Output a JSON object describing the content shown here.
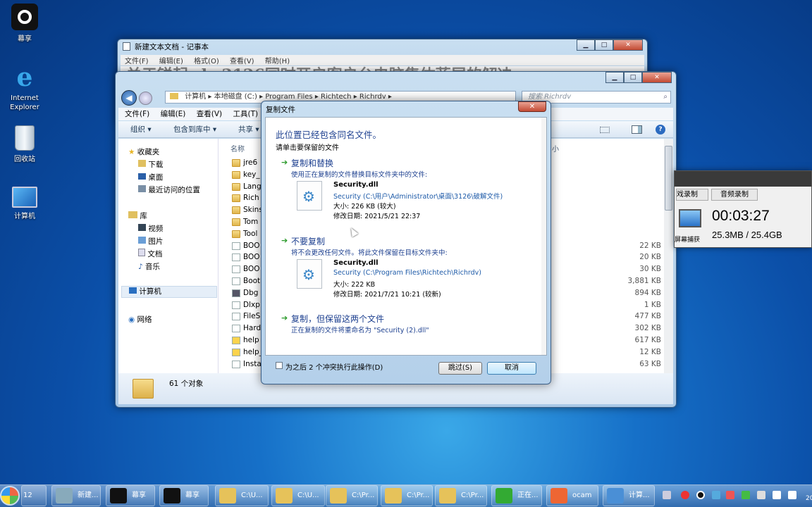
{
  "desktop": {
    "icons": [
      {
        "label": "幕享"
      },
      {
        "label": "Internet Explorer"
      },
      {
        "label": "回收站"
      },
      {
        "label": "计算机"
      }
    ]
  },
  "notepad": {
    "title": "新建文本文档 - 记事本",
    "menu": [
      "文件(F)",
      "编辑(E)",
      "格式(O)",
      "查看(V)",
      "帮助(H)"
    ],
    "text": "关于锐起rdv 3126同时开启客户台电脑集体蓝屏的解决"
  },
  "explorer": {
    "breadcrumb": [
      "计算机",
      "本地磁盘 (C:)",
      "Program Files",
      "Richtech",
      "Richrdv"
    ],
    "search_placeholder": "搜索 Richrdv",
    "menu": [
      "文件(F)",
      "编辑(E)",
      "查看(V)",
      "工具(T)"
    ],
    "toolbar": [
      "组织 ▾",
      "包含到库中 ▾",
      "共享 ▾"
    ],
    "nav": {
      "favorites": "收藏夹",
      "fav_items": [
        "下载",
        "桌面",
        "最近访问的位置"
      ],
      "libraries": "库",
      "lib_items": [
        "视频",
        "图片",
        "文档",
        "音乐"
      ],
      "computer": "计算机",
      "network": "网络"
    },
    "col_name": "名称",
    "col_size": "小",
    "files": [
      {
        "name": "jre6",
        "type": "folder",
        "size": ""
      },
      {
        "name": "key_",
        "type": "folder",
        "size": ""
      },
      {
        "name": "Lang",
        "type": "folder",
        "size": ""
      },
      {
        "name": "Rich",
        "type": "folder",
        "size": ""
      },
      {
        "name": "Skins",
        "type": "folder",
        "size": ""
      },
      {
        "name": "Tom",
        "type": "folder",
        "size": ""
      },
      {
        "name": "Tool",
        "type": "folder",
        "size": ""
      },
      {
        "name": "BOO",
        "type": "file",
        "size": "22 KB"
      },
      {
        "name": "BOO",
        "type": "file",
        "size": "20 KB"
      },
      {
        "name": "BOO",
        "type": "file",
        "size": "30 KB"
      },
      {
        "name": "Boot",
        "type": "file",
        "size": "3,881 KB"
      },
      {
        "name": "Dbg",
        "type": "gear",
        "size": "894 KB"
      },
      {
        "name": "Dlxp",
        "type": "file",
        "size": "1 KB"
      },
      {
        "name": "FileS",
        "type": "file",
        "size": "477 KB"
      },
      {
        "name": "Hard",
        "type": "file",
        "size": "302 KB"
      },
      {
        "name": "help",
        "type": "help",
        "size": "617 KB"
      },
      {
        "name": "help_",
        "type": "help",
        "size": "12 KB"
      },
      {
        "name": "Insta",
        "type": "file",
        "size": "63 KB"
      }
    ],
    "status": "61 个对象"
  },
  "copy_dialog": {
    "title": "复制文件",
    "heading": "此位置已经包含同名文件。",
    "subheading": "请单击要保留的文件",
    "options": [
      {
        "title": "复制和替换",
        "desc": "使用正在复制的文件替换目标文件夹中的文件:",
        "file": "Security.dll",
        "path": "Security (C:\\用户\\Administrator\\桌面\\3126\\破解文件)",
        "size": "大小: 226 KB (较大)",
        "date": "修改日期: 2021/5/21 22:37"
      },
      {
        "title": "不要复制",
        "desc": "将不会更改任何文件。将此文件保留在目标文件夹中:",
        "file": "Security.dll",
        "path": "Security (C:\\Program Files\\Richtech\\Richrdv)",
        "size": "大小: 222 KB",
        "date": "修改日期: 2021/7/21 10:21 (较新)"
      },
      {
        "title": "复制，但保留这两个文件",
        "desc": "正在复制的文件将重命名为 \"Security (2).dll\""
      }
    ],
    "checkbox_label": "为之后 2 个冲突执行此操作(D)",
    "skip_button": "跳过(S)",
    "cancel_button": "取消"
  },
  "recorder": {
    "tabs": [
      "戏录制",
      "音频录制"
    ],
    "time": "00:03:27",
    "size": "25.3MB / 25.4GB",
    "icon_label": "屏幕捕获"
  },
  "taskbar": {
    "items": [
      "12首...",
      "新建...",
      "幕享",
      "幕享",
      "C:\\U...",
      "C:\\U...",
      "C:\\Pr...",
      "C:\\Pr...",
      "C:\\Pr...",
      "正在...",
      "ocam",
      "计算..."
    ],
    "clock": "20"
  },
  "colors": {
    "accent": "#1d5aa8",
    "option_title": "#1c3f8f"
  }
}
